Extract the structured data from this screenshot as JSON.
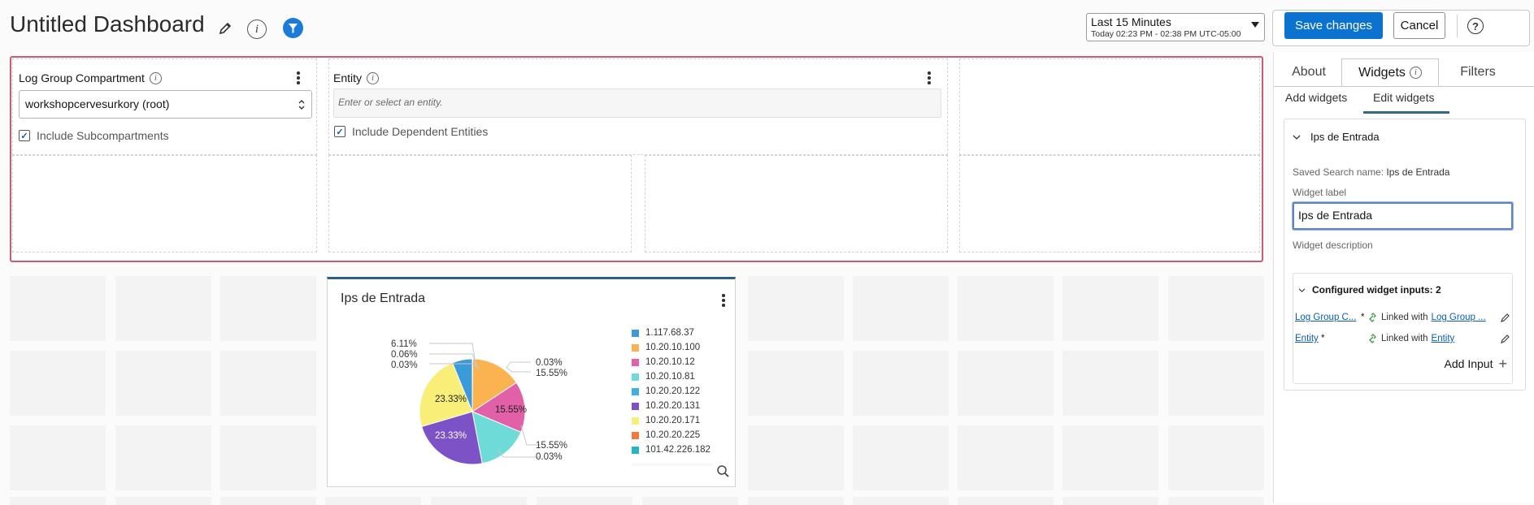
{
  "header": {
    "title": "Untitled Dashboard",
    "info_glyph": "i",
    "time_range": "Last 15 Minutes",
    "time_detail": "Today 02:23 PM - 02:38 PM UTC-05:00",
    "save_label": "Save changes",
    "cancel_label": "Cancel",
    "help_glyph": "?"
  },
  "filters": {
    "compartment": {
      "title": "Log Group Compartment",
      "value": "workshopcervesurkory (root)",
      "checkbox_label": "Include Subcompartments",
      "checked": true
    },
    "entity": {
      "title": "Entity",
      "placeholder": "Enter or select an entity.",
      "checkbox_label": "Include Dependent Entities",
      "checked": true
    }
  },
  "widget": {
    "title": "Ips de Entrada",
    "pie_labels": [
      "6.11%",
      "0.06%",
      "0.03%",
      "23.33%",
      "23.33%",
      "15.55%",
      "0.03%",
      "15.55%",
      "15.55%",
      "0.03%"
    ]
  },
  "chart_data": {
    "type": "pie",
    "title": "Ips de Entrada",
    "categories": [
      "1.117.68.37",
      "10.20.10.100",
      "10.20.10.12",
      "10.20.10.81",
      "10.20.20.122",
      "10.20.20.131",
      "10.20.20.171",
      "10.20.20.225",
      "101.42.226.182"
    ],
    "values": [
      6.11,
      15.55,
      15.55,
      15.55,
      0.03,
      23.33,
      23.33,
      0.06,
      0.03
    ],
    "colors": [
      "#3c9ad8",
      "#fbb250",
      "#e160a8",
      "#6fdbd8",
      "#42aee8",
      "#7d52c6",
      "#f8ee78",
      "#ee7d3b",
      "#25b5c9"
    ]
  },
  "right_panel": {
    "tabs": [
      "About",
      "Widgets",
      "Filters"
    ],
    "active_tab": "Widgets",
    "subtabs": [
      "Add widgets",
      "Edit widgets"
    ],
    "section_title": "Ips de Entrada",
    "saved_search_label": "Saved Search name:",
    "saved_search_value": "Ips de Entrada",
    "widget_label_caption": "Widget label",
    "widget_label_value": "Ips de Entrada",
    "widget_description_caption": "Widget description",
    "configured_inputs_title": "Configured widget inputs: 2",
    "linked_with": "Linked with",
    "required_mark": "*",
    "inputs": [
      {
        "name": "Log Group C...",
        "linked": "Log Group ..."
      },
      {
        "name": "Entity",
        "linked": "Entity"
      }
    ],
    "add_input_label": "Add Input"
  }
}
